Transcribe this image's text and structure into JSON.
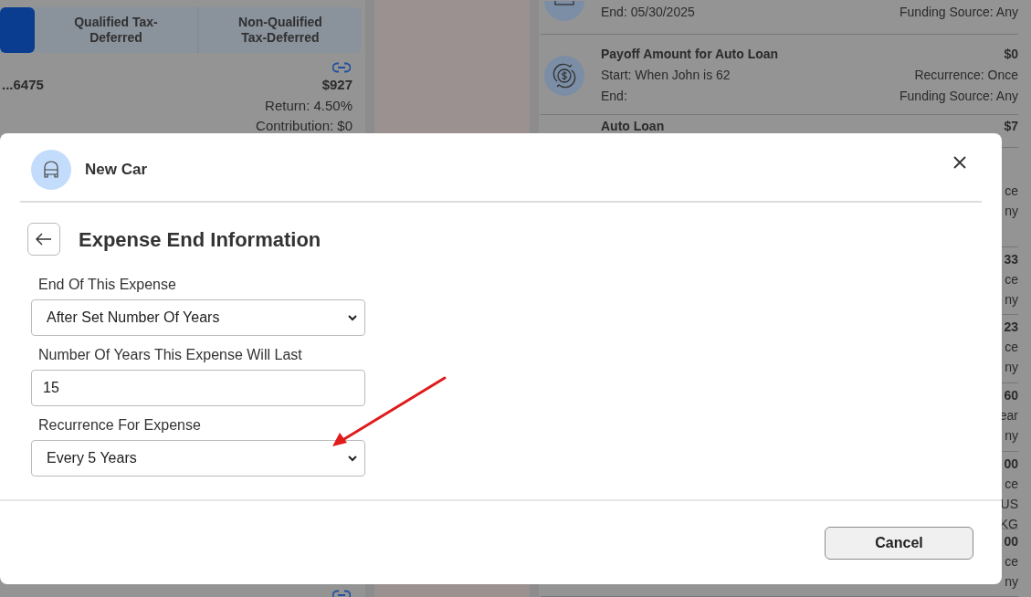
{
  "accounts_panel": {
    "tabs": [
      {
        "selected": true
      },
      {
        "label": "Qualified Tax-Deferred",
        "selected": false
      },
      {
        "label": "Non-Qualified Tax-Deferred",
        "selected": false
      }
    ],
    "account": {
      "number": "...6475",
      "amount": "$927",
      "return": "Return: 4.50%",
      "contribution": "Contribution: $0"
    }
  },
  "expenses_panel": {
    "rows": [
      {
        "lines": [
          "End: 05/30/2025"
        ],
        "right": [
          "Funding Source: Any"
        ]
      },
      {
        "title": "Payoff Amount for Auto Loan",
        "lines": [
          "Start: When John is 62",
          "End:"
        ],
        "right": [
          "$0",
          "Recurrence: Once",
          "Funding Source: Any"
        ]
      },
      {
        "title": "Auto Loan",
        "right": [
          "$7"
        ]
      }
    ],
    "hidden_rows": [
      [
        "ce",
        "ny"
      ],
      [
        "33",
        "ce",
        "ny"
      ],
      [
        "23",
        "ce",
        "ny"
      ],
      [
        "60",
        "ear",
        "ny"
      ],
      [
        "00",
        "ce",
        "US",
        "KG"
      ],
      [
        "00",
        "ce",
        "ny"
      ]
    ]
  },
  "modal": {
    "title": "New Car",
    "heading": "Expense End Information",
    "fields": [
      {
        "kind": "select",
        "label": "End Of This Expense",
        "value": "After Set Number Of Years"
      },
      {
        "kind": "input",
        "label": "Number Of Years This Expense Will Last",
        "value": "15"
      },
      {
        "kind": "select",
        "label": "Recurrence For Expense",
        "value": "Every 5 Years"
      }
    ],
    "buttons": [
      "Cancel"
    ]
  }
}
